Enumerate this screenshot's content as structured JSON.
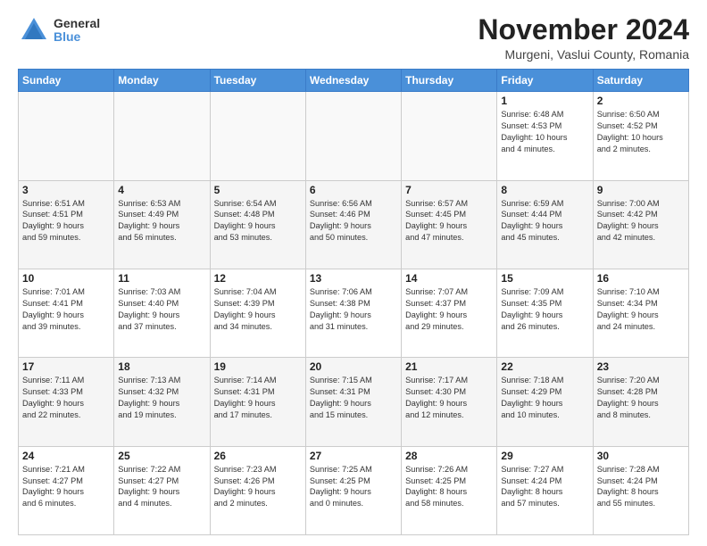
{
  "logo": {
    "general": "General",
    "blue": "Blue"
  },
  "title": "November 2024",
  "location": "Murgeni, Vaslui County, Romania",
  "days_header": [
    "Sunday",
    "Monday",
    "Tuesday",
    "Wednesday",
    "Thursday",
    "Friday",
    "Saturday"
  ],
  "weeks": [
    [
      {
        "day": "",
        "info": ""
      },
      {
        "day": "",
        "info": ""
      },
      {
        "day": "",
        "info": ""
      },
      {
        "day": "",
        "info": ""
      },
      {
        "day": "",
        "info": ""
      },
      {
        "day": "1",
        "info": "Sunrise: 6:48 AM\nSunset: 4:53 PM\nDaylight: 10 hours\nand 4 minutes."
      },
      {
        "day": "2",
        "info": "Sunrise: 6:50 AM\nSunset: 4:52 PM\nDaylight: 10 hours\nand 2 minutes."
      }
    ],
    [
      {
        "day": "3",
        "info": "Sunrise: 6:51 AM\nSunset: 4:51 PM\nDaylight: 9 hours\nand 59 minutes."
      },
      {
        "day": "4",
        "info": "Sunrise: 6:53 AM\nSunset: 4:49 PM\nDaylight: 9 hours\nand 56 minutes."
      },
      {
        "day": "5",
        "info": "Sunrise: 6:54 AM\nSunset: 4:48 PM\nDaylight: 9 hours\nand 53 minutes."
      },
      {
        "day": "6",
        "info": "Sunrise: 6:56 AM\nSunset: 4:46 PM\nDaylight: 9 hours\nand 50 minutes."
      },
      {
        "day": "7",
        "info": "Sunrise: 6:57 AM\nSunset: 4:45 PM\nDaylight: 9 hours\nand 47 minutes."
      },
      {
        "day": "8",
        "info": "Sunrise: 6:59 AM\nSunset: 4:44 PM\nDaylight: 9 hours\nand 45 minutes."
      },
      {
        "day": "9",
        "info": "Sunrise: 7:00 AM\nSunset: 4:42 PM\nDaylight: 9 hours\nand 42 minutes."
      }
    ],
    [
      {
        "day": "10",
        "info": "Sunrise: 7:01 AM\nSunset: 4:41 PM\nDaylight: 9 hours\nand 39 minutes."
      },
      {
        "day": "11",
        "info": "Sunrise: 7:03 AM\nSunset: 4:40 PM\nDaylight: 9 hours\nand 37 minutes."
      },
      {
        "day": "12",
        "info": "Sunrise: 7:04 AM\nSunset: 4:39 PM\nDaylight: 9 hours\nand 34 minutes."
      },
      {
        "day": "13",
        "info": "Sunrise: 7:06 AM\nSunset: 4:38 PM\nDaylight: 9 hours\nand 31 minutes."
      },
      {
        "day": "14",
        "info": "Sunrise: 7:07 AM\nSunset: 4:37 PM\nDaylight: 9 hours\nand 29 minutes."
      },
      {
        "day": "15",
        "info": "Sunrise: 7:09 AM\nSunset: 4:35 PM\nDaylight: 9 hours\nand 26 minutes."
      },
      {
        "day": "16",
        "info": "Sunrise: 7:10 AM\nSunset: 4:34 PM\nDaylight: 9 hours\nand 24 minutes."
      }
    ],
    [
      {
        "day": "17",
        "info": "Sunrise: 7:11 AM\nSunset: 4:33 PM\nDaylight: 9 hours\nand 22 minutes."
      },
      {
        "day": "18",
        "info": "Sunrise: 7:13 AM\nSunset: 4:32 PM\nDaylight: 9 hours\nand 19 minutes."
      },
      {
        "day": "19",
        "info": "Sunrise: 7:14 AM\nSunset: 4:31 PM\nDaylight: 9 hours\nand 17 minutes."
      },
      {
        "day": "20",
        "info": "Sunrise: 7:15 AM\nSunset: 4:31 PM\nDaylight: 9 hours\nand 15 minutes."
      },
      {
        "day": "21",
        "info": "Sunrise: 7:17 AM\nSunset: 4:30 PM\nDaylight: 9 hours\nand 12 minutes."
      },
      {
        "day": "22",
        "info": "Sunrise: 7:18 AM\nSunset: 4:29 PM\nDaylight: 9 hours\nand 10 minutes."
      },
      {
        "day": "23",
        "info": "Sunrise: 7:20 AM\nSunset: 4:28 PM\nDaylight: 9 hours\nand 8 minutes."
      }
    ],
    [
      {
        "day": "24",
        "info": "Sunrise: 7:21 AM\nSunset: 4:27 PM\nDaylight: 9 hours\nand 6 minutes."
      },
      {
        "day": "25",
        "info": "Sunrise: 7:22 AM\nSunset: 4:27 PM\nDaylight: 9 hours\nand 4 minutes."
      },
      {
        "day": "26",
        "info": "Sunrise: 7:23 AM\nSunset: 4:26 PM\nDaylight: 9 hours\nand 2 minutes."
      },
      {
        "day": "27",
        "info": "Sunrise: 7:25 AM\nSunset: 4:25 PM\nDaylight: 9 hours\nand 0 minutes."
      },
      {
        "day": "28",
        "info": "Sunrise: 7:26 AM\nSunset: 4:25 PM\nDaylight: 8 hours\nand 58 minutes."
      },
      {
        "day": "29",
        "info": "Sunrise: 7:27 AM\nSunset: 4:24 PM\nDaylight: 8 hours\nand 57 minutes."
      },
      {
        "day": "30",
        "info": "Sunrise: 7:28 AM\nSunset: 4:24 PM\nDaylight: 8 hours\nand 55 minutes."
      }
    ]
  ]
}
